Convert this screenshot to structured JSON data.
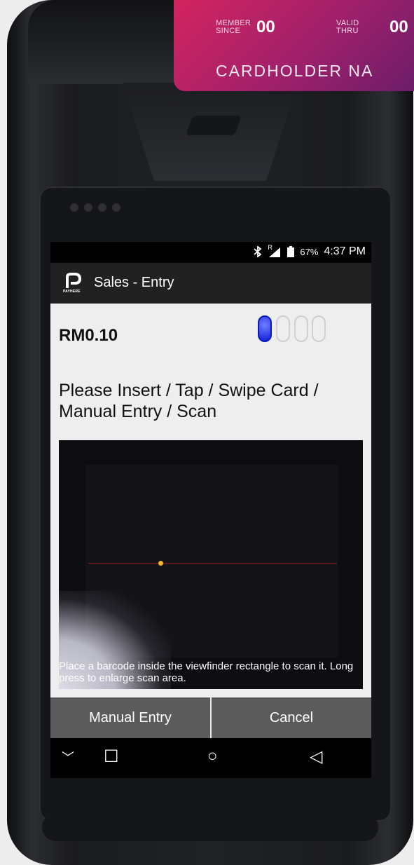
{
  "card": {
    "member_since_label_1": "MEMBER",
    "member_since_label_2": "SINCE",
    "member_since_value": "00",
    "valid_thru_label_1": "VALID",
    "valid_thru_label_2": "THRU",
    "valid_thru_value": "00",
    "cardholder_name": "CARDHOLDER NA"
  },
  "status_bar": {
    "bluetooth_icon": "bluetooth-icon",
    "signal_icon": "signal-icon",
    "roaming_mark": "R",
    "battery_icon": "battery-icon",
    "battery": "67%",
    "time": "4:37 PM"
  },
  "app_bar": {
    "logo_text": "PAYHERE",
    "title": "Sales - Entry"
  },
  "entry": {
    "amount": "RM0.10",
    "pin_slots_filled": 1,
    "pin_slots_total": 4,
    "prompt": "Please Insert / Tap / Swipe Card / Manual Entry / Scan"
  },
  "scanner": {
    "hint": "Place a barcode inside the viewfinder rectangle to scan it. Long press to enlarge scan area."
  },
  "buttons": {
    "manual_entry": "Manual Entry",
    "cancel": "Cancel"
  },
  "nav": {
    "collapse": "﹀",
    "recents": "☐",
    "home": "○",
    "back": "◁"
  },
  "colors": {
    "card_gradient_start": "#d3245f",
    "card_gradient_end": "#6c1d6a",
    "pin_active": "#1020d8",
    "app_bar": "#212121",
    "button_bg": "#5b5b5b"
  }
}
